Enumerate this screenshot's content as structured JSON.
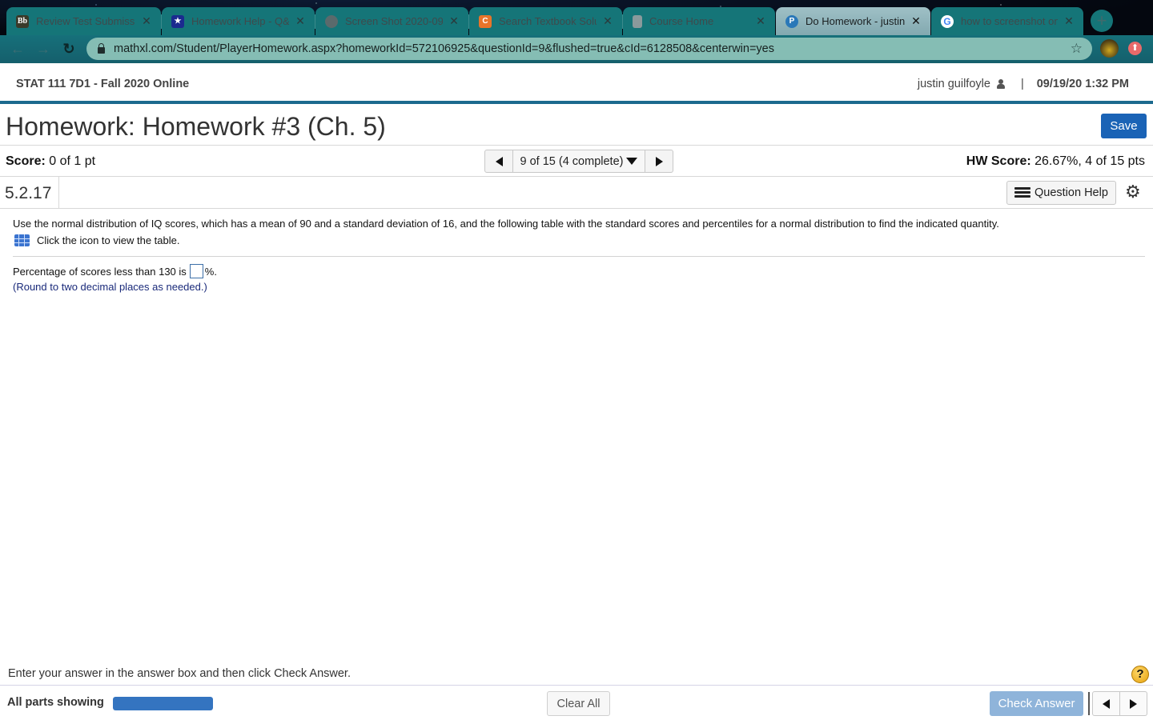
{
  "browser": {
    "tabs": [
      {
        "label": "Review Test Submissio",
        "favicon": "blackboard-icon",
        "active": false
      },
      {
        "label": "Homework Help - Q&A",
        "favicon": "star-shield-icon",
        "active": false
      },
      {
        "label": "Screen Shot 2020-09",
        "favicon": "globe-icon",
        "active": false
      },
      {
        "label": "Search Textbook Solu",
        "favicon": "chegg-icon",
        "active": false
      },
      {
        "label": "Course Home",
        "favicon": "book-icon",
        "active": false
      },
      {
        "label": "Do Homework - justin",
        "favicon": "pearson-icon",
        "active": true
      },
      {
        "label": "how to screenshot on",
        "favicon": "google-icon",
        "active": false
      }
    ],
    "favicon_glyphs": {
      "blackboard": "Bb",
      "star": "★",
      "chegg": "C",
      "pearson": "P",
      "google": "G"
    },
    "close_glyph": "✕",
    "new_tab_glyph": "+",
    "back_glyph": "←",
    "forward_glyph": "→",
    "reload_glyph": "↻",
    "bookmark_glyph": "☆",
    "extension_glyph": "⬆",
    "url": "mathxl.com/Student/PlayerHomework.aspx?homeworkId=572106925&questionId=9&flushed=true&cId=6128508&centerwin=yes"
  },
  "course": {
    "title": "STAT 111 7D1 - Fall 2020 Online",
    "user_name": "justin guilfoyle",
    "separator": "|",
    "datetime": "09/19/20 1:32 PM"
  },
  "homework": {
    "title": "Homework: Homework #3 (Ch. 5)",
    "save_label": "Save"
  },
  "score": {
    "label": "Score:",
    "value": "0 of 1 pt",
    "hw_label": "HW Score:",
    "hw_value": "26.67%, 4 of 15 pts"
  },
  "question_nav": {
    "position": "9 of 15 (4 complete)"
  },
  "question": {
    "id": "5.2.17",
    "help_label": "Question Help",
    "settings_glyph": "⚙",
    "prompt": "Use the normal distribution of IQ scores, which has a mean of 90 and a standard deviation of 16, and the following table with the standard scores and percentiles for a normal distribution to find the indicated quantity.",
    "table_link_text": "Click the icon to view the table.",
    "answer_prefix": "Percentage of scores less than 130 is",
    "answer_value": "",
    "answer_suffix": "%.",
    "hint": "(Round to two decimal places as needed.)"
  },
  "footer": {
    "instruction": "Enter your answer in the answer box and then click Check Answer.",
    "help_glyph": "?",
    "parts_label": "All parts showing",
    "parts_progress_percent": 100,
    "clear_label": "Clear All",
    "check_label": "Check Answer"
  },
  "colors": {
    "accent_blue": "#1a63b6",
    "course_bar_border": "#1c6a8e",
    "check_answer_disabled": "#8fb4da",
    "hint_text": "#1a2a7a",
    "progress_fill": "#3474c0"
  }
}
